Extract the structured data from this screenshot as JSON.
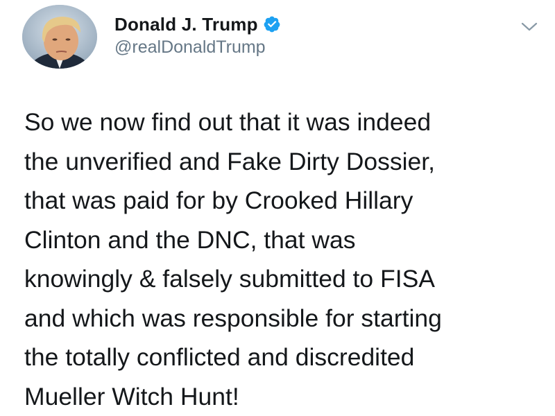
{
  "tweet": {
    "author": {
      "display_name": "Donald J. Trump",
      "handle": "@realDonaldTrump",
      "verified": true,
      "avatar_icon": "profile-photo",
      "verified_icon": "verified-badge-icon"
    },
    "menu_icon": "chevron-down-icon",
    "text_lines": [
      "So we now find out that it was indeed",
      "the unverified and Fake Dirty Dossier,",
      "that was paid for by Crooked Hillary",
      "Clinton and the DNC, that was",
      "knowingly & falsely submitted to FISA",
      "and which was responsible for starting",
      "the totally conflicted and discredited",
      "Mueller Witch Hunt!"
    ]
  },
  "colors": {
    "text": "#14171a",
    "secondary_text": "#657786",
    "verified_blue": "#1da1f2",
    "background": "#ffffff"
  }
}
